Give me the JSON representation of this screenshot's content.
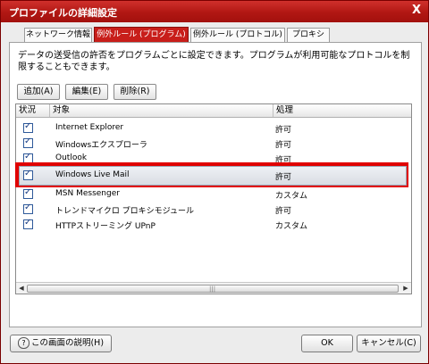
{
  "window": {
    "title": "プロファイルの詳細設定",
    "close_label": "X"
  },
  "tabs": [
    {
      "label": "ネットワーク情報"
    },
    {
      "label": "例外ルール (プログラム)"
    },
    {
      "label": "例外ルール (プロトコル)"
    },
    {
      "label": "プロキシ"
    }
  ],
  "description": "データの送受信の許否をプログラムごとに設定できます。プログラムが利用可能なプロトコルを制限することもできます。",
  "toolbar": {
    "add_label": "追加(A)",
    "edit_label": "編集(E)",
    "delete_label": "削除(R)"
  },
  "columns": {
    "status": "状況",
    "target": "対象",
    "action": "処理"
  },
  "rows": [
    {
      "name": "Internet Explorer",
      "action": "許可"
    },
    {
      "name": "Windowsエクスプローラ",
      "action": "許可"
    },
    {
      "name": "Outlook",
      "action": "許可"
    },
    {
      "name": "Windows Live Mail",
      "action": "許可"
    },
    {
      "name": "MSN Messenger",
      "action": "カスタム"
    },
    {
      "name": "トレンドマイクロ プロキシモジュール",
      "action": "許可"
    },
    {
      "name": "HTTPストリーミング UPnP",
      "action": "カスタム"
    }
  ],
  "checkmark": "✓",
  "footer": {
    "help_label": "この画面の説明(H)",
    "help_icon": "?",
    "ok_label": "OK",
    "cancel_label": "キャンセル(C)"
  },
  "colors": {
    "titlebar": "#b11713",
    "highlight": "#e00000",
    "active_tab": "#c81e1a"
  }
}
